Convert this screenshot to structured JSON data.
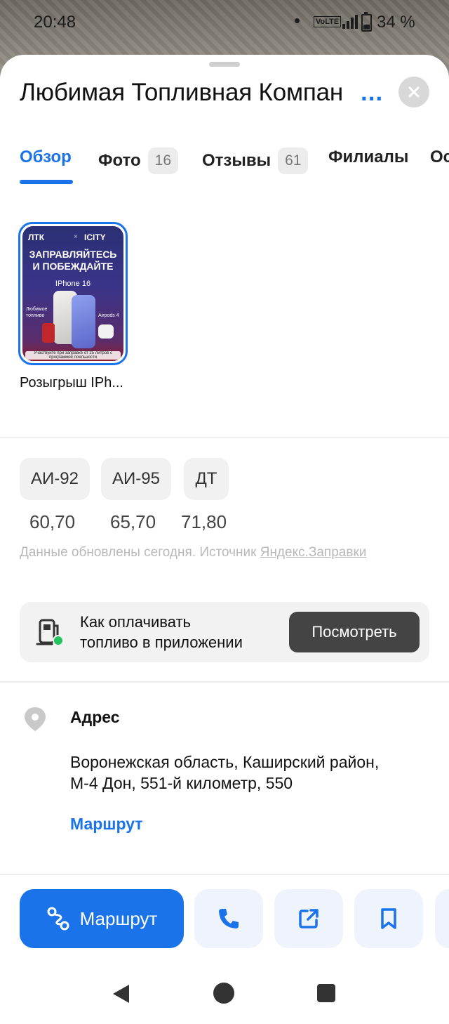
{
  "status_bar": {
    "time": "20:48",
    "network": "VoLTE",
    "battery": "34 %"
  },
  "header": {
    "title": "Любимая Топливная Компан",
    "more": "..."
  },
  "tabs": [
    {
      "label": "Обзор",
      "count": ""
    },
    {
      "label": "Фото",
      "count": "16"
    },
    {
      "label": "Отзывы",
      "count": "61"
    },
    {
      "label": "Филиалы",
      "count": ""
    },
    {
      "label": "Ос",
      "count": ""
    }
  ],
  "story": {
    "brand_left": "ЛТК",
    "brand_x": "×",
    "brand_right": "ICITY",
    "headline_1": "Заправляйтесь",
    "headline_2": "и побеждайте",
    "phone": "IPhone 16",
    "side_left_1": "Любимое",
    "side_left_2": "топливо",
    "side_right": "Airpods 4",
    "footer": "Участвуйте при заправке от 25 литров с программой лояльности",
    "caption": "Розыгрыш IPh..."
  },
  "fuel": {
    "items": [
      {
        "name": "АИ-92",
        "price": "60,70"
      },
      {
        "name": "АИ-95",
        "price": "65,70"
      },
      {
        "name": "ДТ",
        "price": "71,80"
      }
    ],
    "note": "Данные обновлены сегодня. Источник ",
    "source": "Яндекс.Заправки"
  },
  "pay": {
    "line1": "Как оплачивать",
    "line2": "топливо в приложении",
    "button": "Посмотреть"
  },
  "address": {
    "label": "Адрес",
    "line1": "Воронежская область, Каширский район,",
    "line2": "М-4 Дон, 551-й километр, 550",
    "route_link": "Маршрут"
  },
  "actions": {
    "route_label": "Маршрут"
  },
  "colors": {
    "accent": "#1a73e8",
    "dark_button": "#444444",
    "light_bg": "#f2f2f2"
  }
}
